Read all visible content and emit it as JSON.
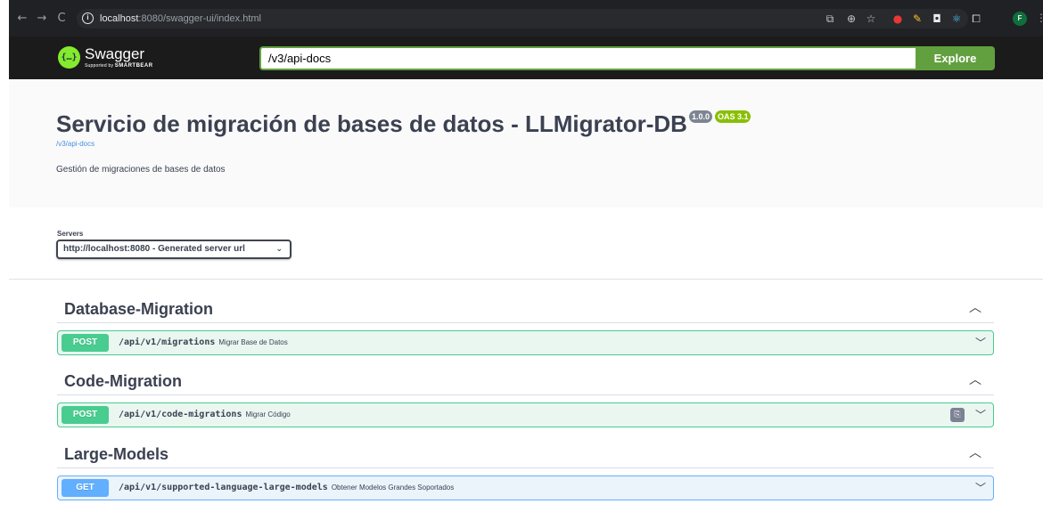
{
  "browser": {
    "url_host": "localhost",
    "url_path": ":8080/swagger-ui/index.html",
    "profile_initial": "F"
  },
  "topbar": {
    "logo_text": "Swagger",
    "logo_sub_prefix": "Supported by",
    "logo_sub_brand": "SMARTBEAR",
    "spec_url_value": "/v3/api-docs",
    "explore_label": "Explore"
  },
  "info": {
    "title": "Servicio de migración de bases de datos - LLMigrator-DB",
    "version": "1.0.0",
    "oas_version": "OAS 3.1",
    "spec_link": "/v3/api-docs",
    "description": "Gestión de migraciones de bases de datos"
  },
  "servers": {
    "label": "Servers",
    "selected": "http://localhost:8080 - Generated server url"
  },
  "tags": [
    {
      "name": "Database-Migration",
      "operations": [
        {
          "method": "POST",
          "path": "/api/v1/migrations",
          "summary": "Migrar Base de Datos"
        }
      ]
    },
    {
      "name": "Code-Migration",
      "operations": [
        {
          "method": "POST",
          "path": "/api/v1/code-migrations",
          "summary": "Migrar Código"
        }
      ]
    },
    {
      "name": "Large-Models",
      "operations": [
        {
          "method": "GET",
          "path": "/api/v1/supported-language-large-models",
          "summary": "Obtener Modelos Grandes Soportados"
        }
      ]
    }
  ],
  "colors": {
    "post": "#49cc90",
    "get": "#61affe",
    "topbar_bg": "#1b1b1b",
    "explore": "#62a03f"
  }
}
